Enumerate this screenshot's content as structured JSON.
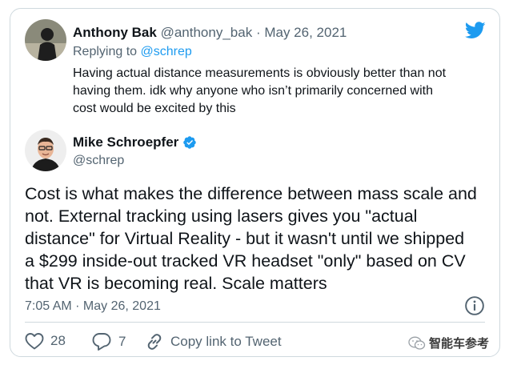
{
  "reply_tweet": {
    "display_name": "Anthony Bak",
    "handle": "@anthony_bak",
    "separator": "·",
    "date": "May 26, 2021",
    "replying_prefix": "Replying to",
    "replying_to": "@schrep",
    "text_lines": [
      "Having actual distance measurements is obviously better than not",
      "having them.  idk why anyone who isn’t primarily concerned with",
      "cost would be excited by this"
    ]
  },
  "main_tweet": {
    "display_name": "Mike Schroepfer",
    "verified": true,
    "handle": "@schrep",
    "text_lines": [
      "Cost is what makes the difference between mass scale and",
      "not.  External tracking using lasers gives you \"actual",
      "distance\" for Virtual Reality - but it wasn't until we shipped",
      "a $299 inside-out tracked VR headset \"only\" based on CV",
      "that VR is becoming real.  Scale matters"
    ],
    "timestamp": "7:05 AM · May 26, 2021"
  },
  "actions": {
    "likes": "28",
    "replies": "7",
    "copy_link_label": "Copy link to Tweet"
  },
  "watermark": "智能车参考",
  "colors": {
    "twitter_blue": "#1d9bf0",
    "muted_text": "#536471",
    "divider": "#cfd9de"
  }
}
